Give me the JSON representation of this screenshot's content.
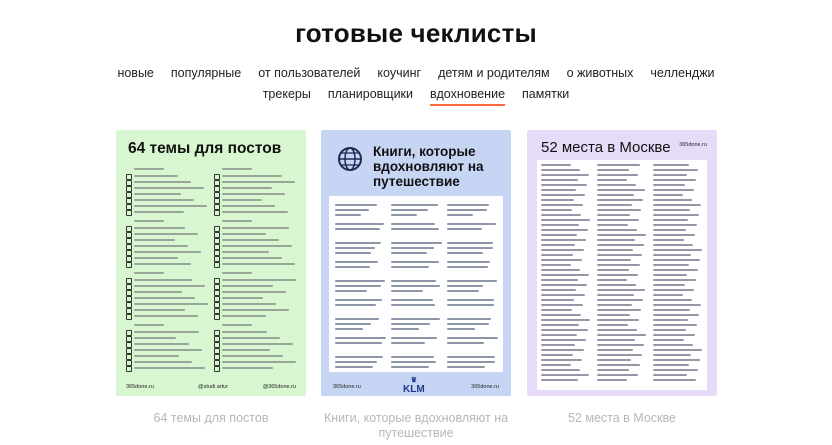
{
  "title": "готовые чеклисты",
  "categories_row1": [
    "новые",
    "популярные",
    "от пользователей",
    "коучинг",
    "детям и родителям",
    "о животных",
    "челленджи"
  ],
  "categories_row2": [
    "трекеры",
    "планировщики",
    "вдохновение",
    "памятки"
  ],
  "active_category": "вдохновение",
  "accent_color": "#ff6a3d",
  "cards": [
    {
      "preview_title": "64 темы для постов",
      "caption": "64 темы для постов",
      "footer_left": "365done.ru",
      "footer_mid": "@studi.artur",
      "footer_right": "@365done.ru",
      "bg": "#d8f7d0"
    },
    {
      "preview_title": "Книги, которые вдохновляют на путешествие",
      "caption": "Книги, которые вдохновляют на путешествие",
      "footer_left": "365done.ru",
      "footer_right": "365done.ru",
      "brand": "KLM",
      "bg": "#c7d5f5"
    },
    {
      "preview_title": "52 места в Москве",
      "caption": "52 места в Москве",
      "header_right": "365done.ru",
      "bg": "#e7dbfa"
    }
  ],
  "icons": [
    "globe-icon",
    "crown-icon"
  ]
}
